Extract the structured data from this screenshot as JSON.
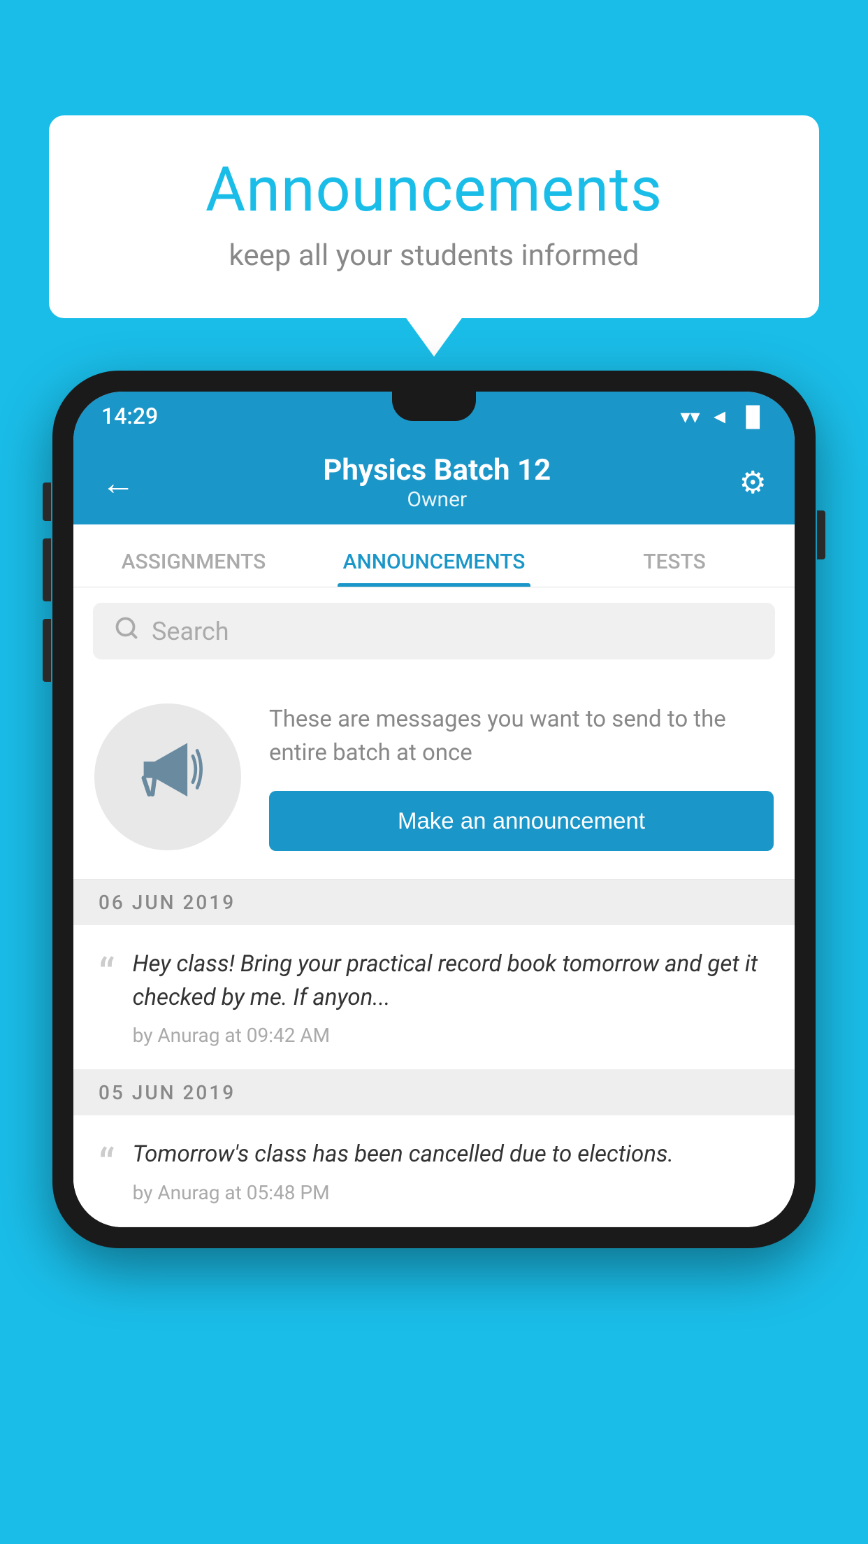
{
  "page": {
    "background_color": "#1ABDE8"
  },
  "speech_bubble": {
    "title": "Announcements",
    "subtitle": "keep all your students informed"
  },
  "phone": {
    "status_bar": {
      "time": "14:29",
      "wifi": "▼",
      "signal": "▲",
      "battery": "▐"
    },
    "app_bar": {
      "back_label": "←",
      "title": "Physics Batch 12",
      "subtitle": "Owner",
      "settings_label": "⚙"
    },
    "tabs": [
      {
        "label": "ASSIGNMENTS",
        "active": false
      },
      {
        "label": "ANNOUNCEMENTS",
        "active": true
      },
      {
        "label": "TESTS",
        "active": false
      }
    ],
    "search": {
      "placeholder": "Search"
    },
    "announcement_prompt": {
      "description": "These are messages you want to send to the entire batch at once",
      "button_label": "Make an announcement"
    },
    "announcement_items": [
      {
        "date": "06  JUN  2019",
        "text": "Hey class! Bring your practical record book tomorrow and get it checked by me. If anyon...",
        "meta": "by Anurag at 09:42 AM"
      },
      {
        "date": "05  JUN  2019",
        "text": "Tomorrow's class has been cancelled due to elections.",
        "meta": "by Anurag at 05:48 PM"
      }
    ]
  }
}
